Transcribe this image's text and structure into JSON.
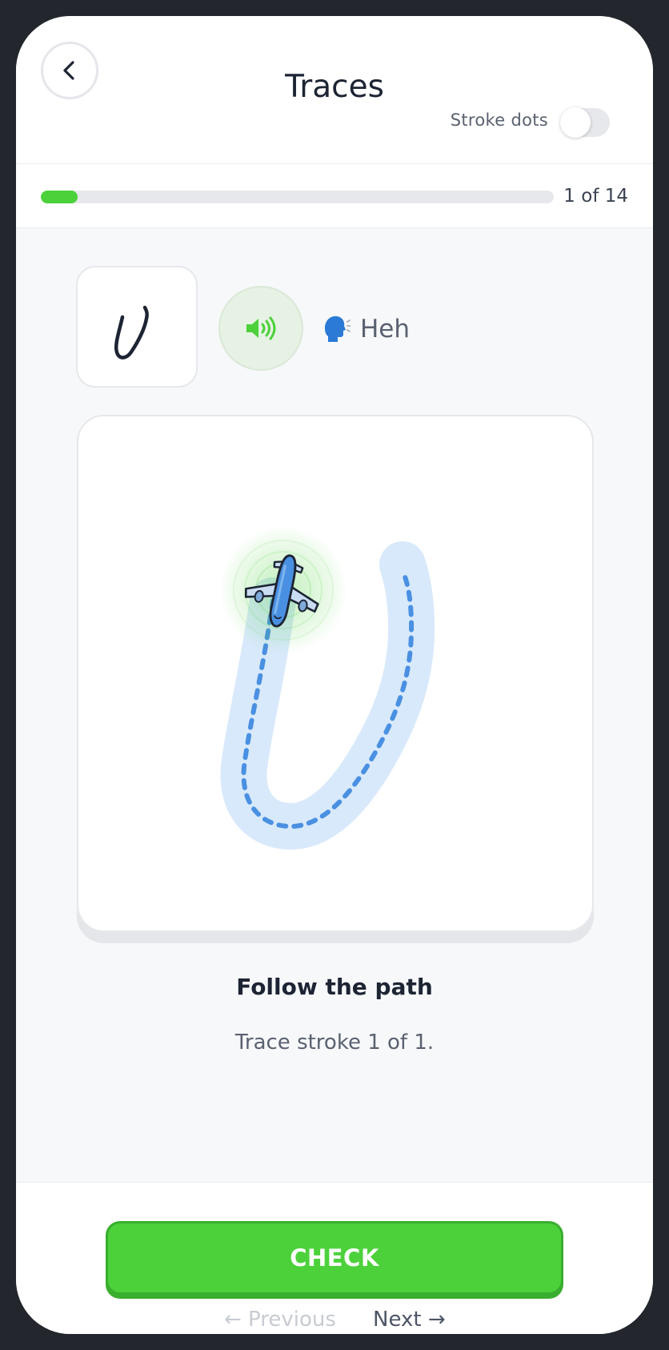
{
  "header": {
    "title": "Traces",
    "stroke_dots_label": "Stroke dots",
    "stroke_dots_enabled": false
  },
  "progress": {
    "current": 1,
    "total": 14,
    "label": "1 of 14",
    "fraction": 0.0714
  },
  "letter": {
    "glyph_icon": "handwritten-u-letter",
    "audio_icon": "speaker-icon",
    "pronunciation_icon": "speaking-head-icon",
    "pronunciation": "Heh"
  },
  "canvas": {
    "guide_icon": "airplane-icon",
    "path_color": "#d8e9fb",
    "dash_color": "#4a90e2"
  },
  "instruction": {
    "title": "Follow the path",
    "subtitle": "Trace stroke 1 of 1."
  },
  "footer": {
    "check_label": "CHECK",
    "previous_label": "← Previous",
    "next_label": "Next →"
  },
  "colors": {
    "accent_green": "#4cd13b",
    "accent_blue": "#4a90e2",
    "text_dark": "#1d2433"
  }
}
